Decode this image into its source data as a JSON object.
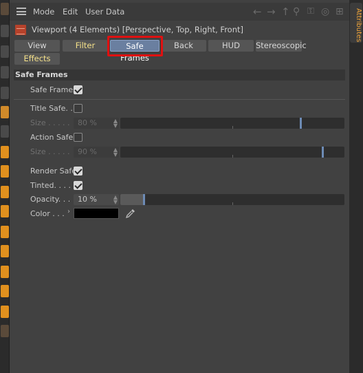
{
  "menubar": {
    "items": [
      "Mode",
      "Edit",
      "User Data"
    ]
  },
  "panel_title": "Viewport (4 Elements) [Perspective, Top, Right, Front]",
  "right_tab": {
    "label": "Attributes"
  },
  "tabs": [
    "View",
    "Filter",
    "Safe Frames",
    "Back",
    "HUD",
    "Stereoscopic",
    "Effects"
  ],
  "active_tab": "Safe Frames",
  "section": {
    "title": "Safe Frames"
  },
  "fields": {
    "safe_frames": {
      "label": "Safe Frames",
      "checked": true
    },
    "title_safe": {
      "label": "Title Safe. .",
      "checked": false
    },
    "title_size": {
      "label": "Size . . . . .",
      "value": "80 %",
      "fraction": 0.8
    },
    "action_safe": {
      "label": "Action Safe",
      "checked": false
    },
    "action_size": {
      "label": "Size . . . . .",
      "value": "90 %",
      "fraction": 0.9
    },
    "render_safe": {
      "label": "Render Safe",
      "checked": true
    },
    "tinted": {
      "label": "Tinted. . . .",
      "checked": true
    },
    "opacity": {
      "label": "Opacity. . .",
      "value": "10 %",
      "fraction": 0.1
    },
    "color": {
      "label": "Color . . .",
      "value": "#000000"
    }
  },
  "colors": {
    "accent": "#f0a53a",
    "highlight": "#e01010",
    "active_tab": "#6a7fa0"
  },
  "icons": [
    "hamburger-icon",
    "back-arrow-icon",
    "forward-arrow-icon",
    "up-arrow-icon",
    "search-icon",
    "lock-icon",
    "target-icon",
    "new-window-icon",
    "viewport-icon",
    "eyedropper-icon"
  ]
}
